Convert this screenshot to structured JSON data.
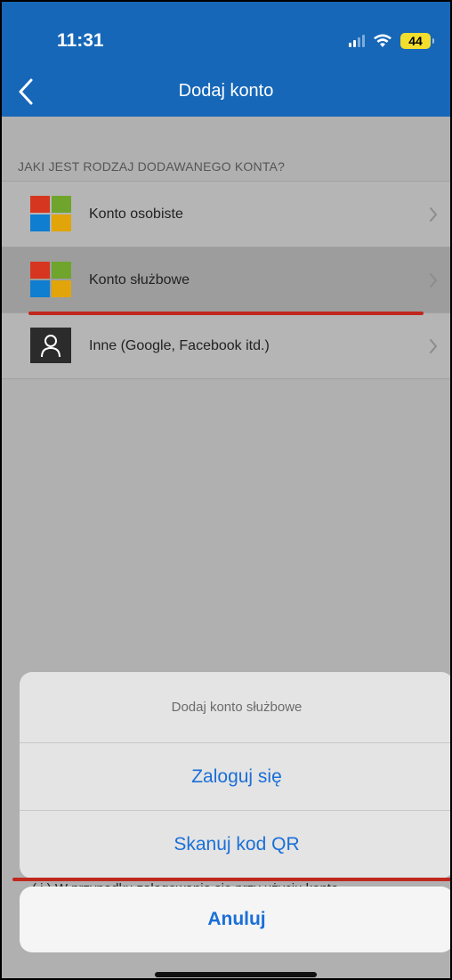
{
  "status_bar": {
    "time": "11:31",
    "battery": "44"
  },
  "nav": {
    "title": "Dodaj konto",
    "back_icon": "chevron-left-icon"
  },
  "section": {
    "header": "JAKI JEST RODZAJ DODAWANEGO KONTA?"
  },
  "accounts": [
    {
      "label": "Konto osobiste",
      "icon": "microsoft-logo-icon"
    },
    {
      "label": "Konto służbowe",
      "icon": "microsoft-logo-icon"
    },
    {
      "label": "Inne (Google, Facebook itd.)",
      "icon": "person-icon"
    }
  ],
  "action_sheet": {
    "title": "Dodaj konto służbowe",
    "sign_in": "Zaloguj się",
    "scan_qr": "Skanuj kod QR",
    "cancel": "Anuluj"
  },
  "info": {
    "text": "( i )  W przypadku zalogowania się przy użyciu konta"
  },
  "colors": {
    "header_blue": "#1667b8",
    "action_blue": "#1a6fd8",
    "annotation_red": "#c0271d",
    "ms_red": "#d6361f",
    "ms_green": "#6fa52c",
    "ms_blue": "#0f7dd0",
    "ms_yellow": "#e1a50a"
  }
}
